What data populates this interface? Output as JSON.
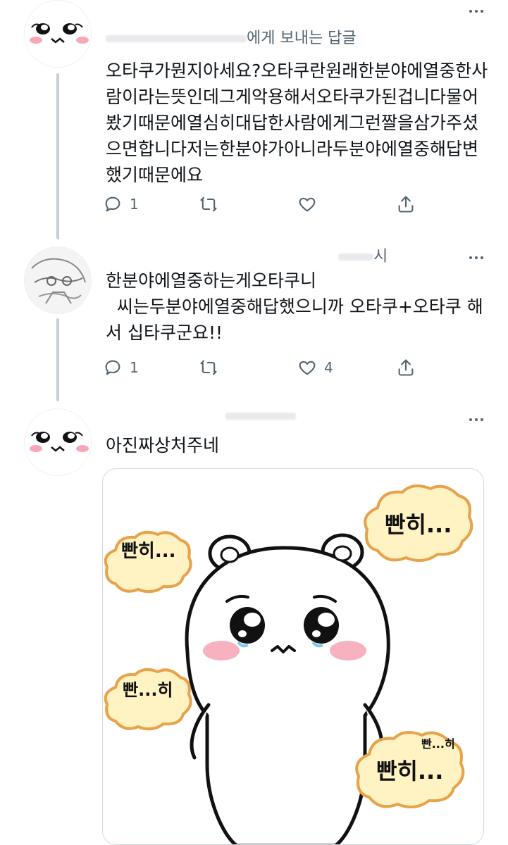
{
  "tweets": [
    {
      "header": "에게 보내는 답글",
      "text": "오타쿠가뭔지아세요?오타쿠란원래한분야에열중한사람이라는뜻인데그게악용해서오타쿠가된겁니다물어봤기때문에열심히대답한사람에게그런짤을삼가주셨으면합니다저는한분야가아니라두분야에열중해답변했기때문에요",
      "reply_count": "1",
      "retweet_count": "",
      "like_count": ""
    },
    {
      "header": "시",
      "text": "한분야에열중하는게오타쿠니\n  씨는두분야에열중해답했으니까 오타쿠+오타쿠 해서 십타쿠군요!!",
      "reply_count": "1",
      "retweet_count": "",
      "like_count": "4"
    },
    {
      "header": "",
      "text": "아진짜상처주네",
      "media_texts": [
        "빤히...",
        "빤히...",
        "빤...히",
        "빤히...",
        "빤...히"
      ]
    }
  ],
  "icons": {
    "reply": "reply-icon",
    "retweet": "retweet-icon",
    "like": "heart-icon",
    "share": "share-icon",
    "more": "more-icon"
  },
  "colors": {
    "text": "#0f1419",
    "secondary": "#536471",
    "thread_line": "#c4cfd6",
    "blush": "#f7a8b8"
  }
}
